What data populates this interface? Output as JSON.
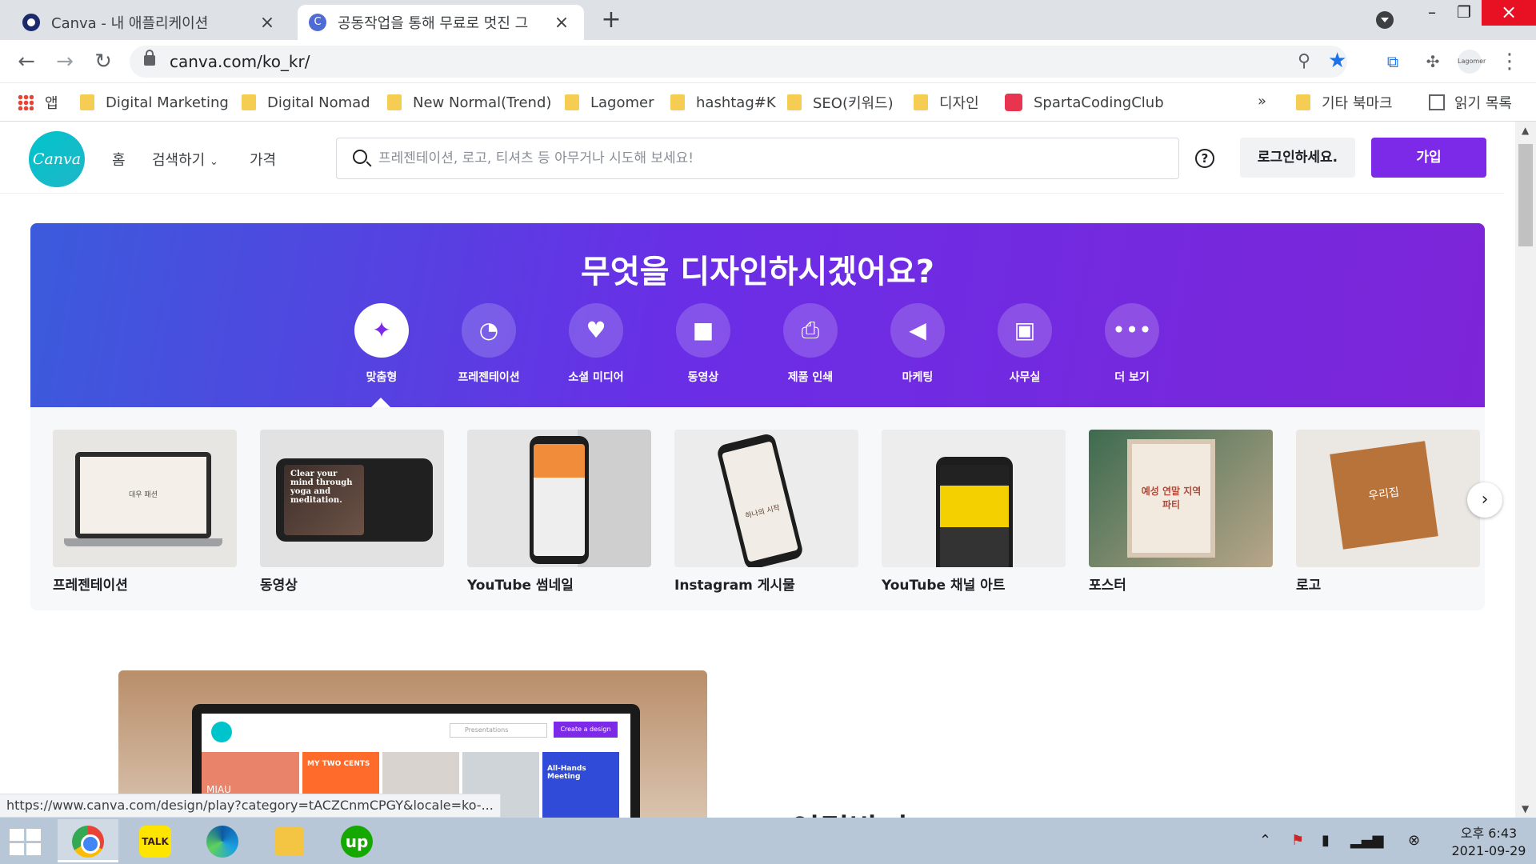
{
  "browser": {
    "tabs": [
      {
        "title": "Canva - 내 애플리케이션",
        "active": false
      },
      {
        "title": "공동작업을 통해 무료로 멋진 그",
        "active": true
      }
    ],
    "new_tab_symbol": "+",
    "url": "canva.com/ko_kr/",
    "profile_label": "Lagomer",
    "bookmarks": [
      {
        "label": "앱",
        "icon": "apps-grid-icon"
      },
      {
        "label": "Digital Marketing",
        "icon": "folder-icon"
      },
      {
        "label": "Digital Nomad",
        "icon": "folder-icon"
      },
      {
        "label": "New Normal(Trend)",
        "icon": "folder-icon"
      },
      {
        "label": "Lagomer",
        "icon": "folder-icon"
      },
      {
        "label": "hashtag#K",
        "icon": "folder-icon"
      },
      {
        "label": "SEO(키워드)",
        "icon": "folder-icon"
      },
      {
        "label": "디자인",
        "icon": "folder-icon"
      },
      {
        "label": "SpartaCodingClub",
        "icon": "sparta-logo-icon"
      }
    ],
    "bookmarks_overflow": "»",
    "other_bookmarks": "기타 북마크",
    "reading_list": "읽기 목록",
    "status_url": "https://www.canva.com/design/play?category=tACZCnmCPGY&locale=ko-..."
  },
  "canva": {
    "logo_text": "Canva",
    "nav": {
      "home": "홈",
      "browse": "검색하기",
      "pricing": "가격"
    },
    "search_placeholder": "프레젠테이션, 로고, 티셔츠 등 아무거나 시도해 보세요!",
    "login": "로그인하세요.",
    "signup": "가입",
    "hero_title": "무엇을 디자인하시겠어요?",
    "categories": [
      {
        "label": "맞춤형",
        "icon": "sparkle-icon",
        "selected": true
      },
      {
        "label": "프레젠테이션",
        "icon": "presentation-icon"
      },
      {
        "label": "소셜 미디어",
        "icon": "heart-icon"
      },
      {
        "label": "동영상",
        "icon": "video-camera-icon"
      },
      {
        "label": "제품 인쇄",
        "icon": "printer-icon"
      },
      {
        "label": "마케팅",
        "icon": "megaphone-icon"
      },
      {
        "label": "사무실",
        "icon": "briefcase-icon"
      },
      {
        "label": "더 보기",
        "icon": "more-dots-icon"
      }
    ],
    "templates": [
      {
        "label": "프레젠테이션",
        "thumb_text": "대우 패션"
      },
      {
        "label": "동영상",
        "thumb_text": "Clear your mind through yoga and meditation."
      },
      {
        "label": "YouTube 썸네일",
        "thumb_text": ""
      },
      {
        "label": "Instagram 게시물",
        "thumb_text": "하나의 시작"
      },
      {
        "label": "YouTube 채널 아트",
        "thumb_text": ""
      },
      {
        "label": "포스터",
        "thumb_text": "예성 연말 지역 파티"
      },
      {
        "label": "로고",
        "thumb_text": "우리집"
      }
    ],
    "promo": {
      "search_text": "Presentations",
      "create_button": "Create a design",
      "tile_texts": [
        "MIAU",
        "MY TWO CENTS",
        "All-Hands Meeting"
      ]
    },
    "section_title": "연결받기"
  },
  "taskbar": {
    "apps": [
      {
        "name": "chrome",
        "active": true
      },
      {
        "name": "kakaotalk",
        "label": "TALK"
      },
      {
        "name": "edge"
      },
      {
        "name": "file-explorer"
      },
      {
        "name": "upwork",
        "label": "up"
      }
    ],
    "time": "오후 6:43",
    "date": "2021-09-29"
  },
  "colors": {
    "canva_purple": "#7d2ae8",
    "canva_teal": "#00c4cc",
    "close_red": "#e81123",
    "chrome_blue": "#1a73e8"
  }
}
